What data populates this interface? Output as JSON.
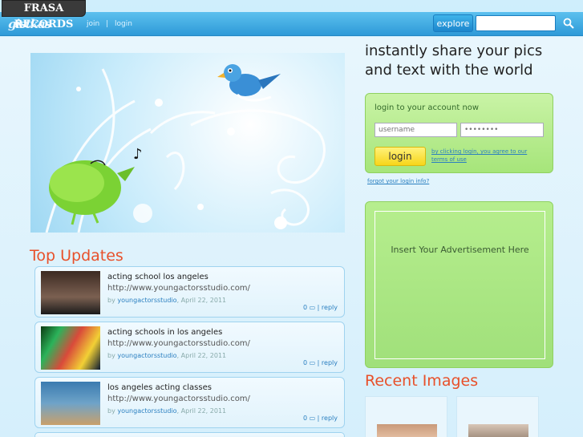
{
  "watermark": "FRASA RECORDS",
  "header": {
    "logo": "gistkas",
    "join_label": "join",
    "separator": "|",
    "login_label": "login",
    "explore_label": "explore",
    "search_placeholder": ""
  },
  "updates": {
    "title": "Top Updates",
    "items": [
      {
        "title": "acting school los angeles",
        "url": "http://www.youngactorsstudio.com/",
        "by": "by",
        "author": "youngactorsstudio",
        "date": "April 22, 2011",
        "count": "0",
        "reply": "reply"
      },
      {
        "title": "acting schools in los angeles",
        "url": "http://www.youngactorsstudio.com/",
        "by": "by",
        "author": "youngactorsstudio",
        "date": "April 22, 2011",
        "count": "0",
        "reply": "reply"
      },
      {
        "title": "los angeles acting classes",
        "url": "http://www.youngactorsstudio.com/",
        "by": "by",
        "author": "youngactorsstudio",
        "date": "April 22, 2011",
        "count": "0",
        "reply": "reply"
      }
    ]
  },
  "sidebar": {
    "tagline": "instantly share your pics and text with the world",
    "login": {
      "title": "login to your account now",
      "username_placeholder": "username",
      "password_placeholder": "••••••••",
      "button": "login",
      "terms": "by clicking login, you agree to our terms of use",
      "forgot": "forgot your login info?"
    },
    "ad_text": "Insert Your Advertisement Here",
    "recent_title": "Recent Images"
  },
  "colors": {
    "accent": "#e8502a",
    "header_blue": "#2e9ad8",
    "login_green": "#a6e57a",
    "button_yellow": "#f7d51a"
  }
}
